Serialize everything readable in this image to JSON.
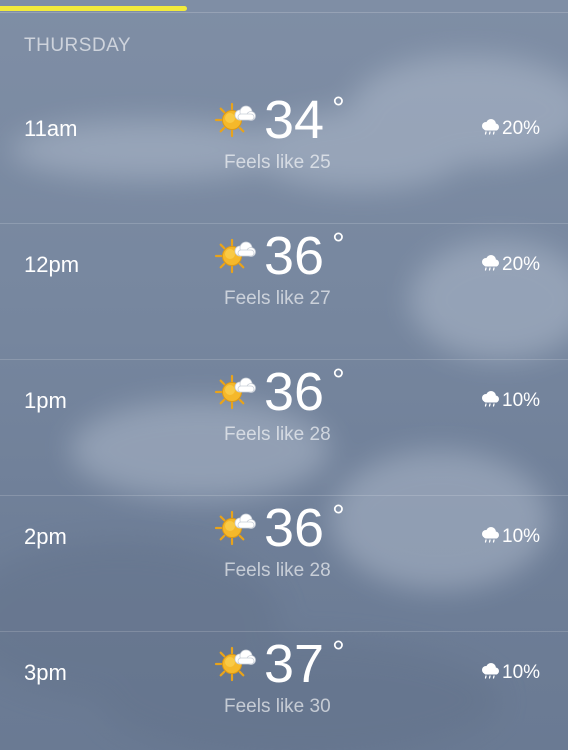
{
  "progress": {
    "fraction": 0.33,
    "color": "#f2ea3b"
  },
  "day": "THURSDAY",
  "hours": [
    {
      "time": "11am",
      "icon": "partly-sunny-icon",
      "temp": "34",
      "degree": "°",
      "feels": "Feels like 25",
      "precip_icon": "rain-cloud-icon",
      "precip": "20%"
    },
    {
      "time": "12pm",
      "icon": "partly-sunny-icon",
      "temp": "36",
      "degree": "°",
      "feels": "Feels like 27",
      "precip_icon": "rain-cloud-icon",
      "precip": "20%"
    },
    {
      "time": "1pm",
      "icon": "partly-sunny-icon",
      "temp": "36",
      "degree": "°",
      "feels": "Feels like 28",
      "precip_icon": "rain-cloud-icon",
      "precip": "10%"
    },
    {
      "time": "2pm",
      "icon": "partly-sunny-icon",
      "temp": "36",
      "degree": "°",
      "feels": "Feels like 28",
      "precip_icon": "rain-cloud-icon",
      "precip": "10%"
    },
    {
      "time": "3pm",
      "icon": "partly-sunny-icon",
      "temp": "37",
      "degree": "°",
      "feels": "Feels like 30",
      "precip_icon": "rain-cloud-icon",
      "precip": "10%"
    }
  ]
}
